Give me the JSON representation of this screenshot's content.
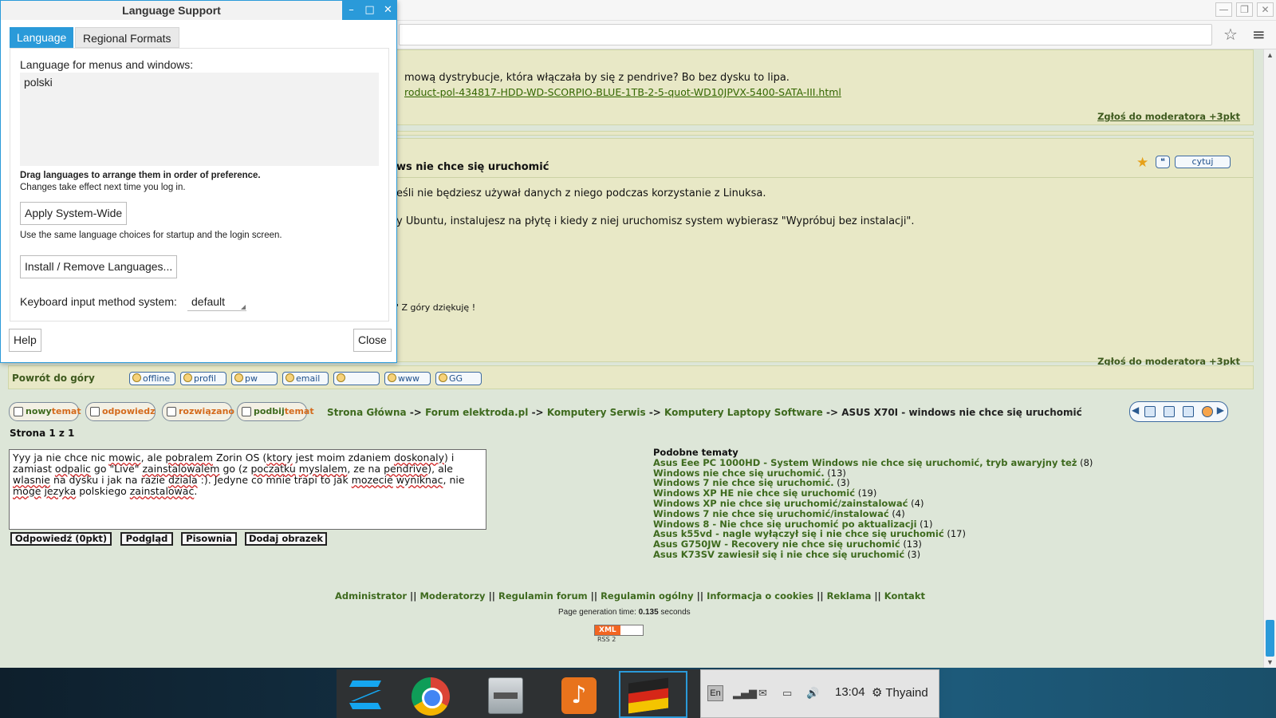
{
  "dialog": {
    "title": "Language Support",
    "tabs": [
      "Language",
      "Regional Formats"
    ],
    "language_label": "Language for menus and windows:",
    "languages": [
      "polski"
    ],
    "drag_hint": "Drag languages to arrange them in order of preference.",
    "changes_hint": "Changes take effect next time you log in.",
    "apply_button": "Apply System-Wide",
    "apply_hint": "Use the same language choices for startup and the login screen.",
    "install_button": "Install / Remove Languages...",
    "keyboard_label": "Keyboard input method system:",
    "keyboard_value": "default",
    "help_button": "Help",
    "close_button": "Close"
  },
  "browser": {
    "window_controls": [
      "—",
      "❐",
      "✕"
    ]
  },
  "post1": {
    "text": "mową dystrybucje, która włączała by się z pendrive? Bo bez dysku to lipa.",
    "link": "roduct-pol-434817-HDD-WD-SCORPIO-BLUE-1TB-2-5-quot-WD10JPVX-5400-SATA-III.html",
    "report": "Zgłoś do moderatora +3pkt"
  },
  "post2": {
    "title": "ws nie chce się uruchomić",
    "quote_button": "cytuj",
    "line1": "eśli nie będziesz używał danych z niego podczas korzystanie z Linuksa.",
    "line2": "y Ubuntu, instalujesz na płytę i kiedy z niej uruchomisz system wybierasz \"Wypróbuj bez instalacji\".",
    "line3": "' Z góry dziękuję !",
    "report": "Zgłoś do moderatora +3pkt"
  },
  "topbar": {
    "back_to_top": "Powrót do góry",
    "buttons": [
      "offline",
      "profil",
      "pw",
      "email",
      "",
      "www",
      "GG"
    ]
  },
  "actions": {
    "new_topic": [
      "nowy",
      "temat"
    ],
    "reply": "odpowiedz",
    "solved": "rozwiązano",
    "bump": [
      "podbij",
      "temat"
    ]
  },
  "breadcrumb": {
    "items": [
      "Strona Główna",
      "Forum elektroda.pl",
      "Komputery Serwis",
      "Komputery Laptopy Software"
    ],
    "separator": "->",
    "current": "ASUS X70I - windows nie chce się uruchomić"
  },
  "page_info": "Strona 1 z 1",
  "reply": {
    "text_parts": [
      {
        "t": "Yyy ja nie chce nic ",
        "s": false
      },
      {
        "t": "mowic",
        "s": true
      },
      {
        "t": ", ale ",
        "s": false
      },
      {
        "t": "pobralem",
        "s": true
      },
      {
        "t": " Zorin OS (",
        "s": false
      },
      {
        "t": "ktory",
        "s": true
      },
      {
        "t": " jest moim zdaniem ",
        "s": false
      },
      {
        "t": "doskonaly",
        "s": true
      },
      {
        "t": ") i zamiast ",
        "s": false
      },
      {
        "t": "odpalic",
        "s": true
      },
      {
        "t": " go \"Live\" ",
        "s": false
      },
      {
        "t": "zainstalowalem",
        "s": true
      },
      {
        "t": " go (z ",
        "s": false
      },
      {
        "t": "poczatku",
        "s": true
      },
      {
        "t": " ",
        "s": false
      },
      {
        "t": "myslalem",
        "s": true
      },
      {
        "t": ", ze na ",
        "s": false
      },
      {
        "t": "pendrive",
        "s": true
      },
      {
        "t": "), ale ",
        "s": false
      },
      {
        "t": "wlasnie",
        "s": true
      },
      {
        "t": " na dysku i jak na razie ",
        "s": false
      },
      {
        "t": "dziala",
        "s": true
      },
      {
        "t": " :). Jedyne co mnie trapi to jak ",
        "s": false
      },
      {
        "t": "mozecie",
        "s": true
      },
      {
        "t": " ",
        "s": false
      },
      {
        "t": "wyniknac",
        "s": true
      },
      {
        "t": ", nie ",
        "s": false
      },
      {
        "t": "moge",
        "s": true
      },
      {
        "t": " ",
        "s": false
      },
      {
        "t": "jezyka",
        "s": true
      },
      {
        "t": " polskiego ",
        "s": false
      },
      {
        "t": "zainstalowac",
        "s": true
      },
      {
        "t": ".",
        "s": false
      }
    ],
    "buttons": [
      "Odpowiedź (0pkt)",
      "Podgląd",
      "Pisownia",
      "Dodaj obrazek"
    ]
  },
  "similar": {
    "title": "Podobne tematy",
    "items": [
      {
        "title": "Asus Eee PC 1000HD - System Windows nie chce się uruchomić, tryb awaryjny też",
        "count": "(8)"
      },
      {
        "title": "Windows nie chce się uruchomić.",
        "count": "(13)"
      },
      {
        "title": "Windows 7 nie chce się uruchomić.",
        "count": "(3)"
      },
      {
        "title": "Windows XP HE nie chce się uruchomić",
        "count": "(19)"
      },
      {
        "title": "Windows XP nie chce się uruchomić/zainstalować",
        "count": "(4)"
      },
      {
        "title": "Windows 7 nie chce się uruchomić/instalować",
        "count": "(4)"
      },
      {
        "title": "Windows 8 - Nie chce się uruchomić po aktualizacji",
        "count": "(1)"
      },
      {
        "title": "Asus k55vd - nagle wyłączył się i nie chce się uruchomić",
        "count": "(17)"
      },
      {
        "title": "Asus G750JW - Recovery nie chce się uruchomić",
        "count": "(13)"
      },
      {
        "title": "Asus K73SV zawiesił się i nie chce się uruchomić",
        "count": "(3)"
      }
    ]
  },
  "footer": {
    "links": [
      "Administrator",
      "Moderatorzy",
      "Regulamin forum",
      "Regulamin ogólny",
      "Informacja o cookies",
      "Reklama",
      "Kontakt"
    ],
    "separator": "||",
    "gen_label": "Page generation time: ",
    "gen_value": "0.135",
    "gen_unit": " seconds",
    "rss_xml": "XML",
    "rss_label": "RSS 2"
  },
  "tray": {
    "lang": "En",
    "time": "13:04",
    "user": "Thyaind",
    "icons": [
      "signal-icon",
      "mail-icon",
      "battery-icon",
      "volume-icon",
      "gear-icon"
    ]
  },
  "colors": {
    "accent": "#2a9ad9",
    "page_bg": "#dde6d8",
    "post_bg": "#e8e8c6",
    "link_green": "#3e6a1e"
  }
}
